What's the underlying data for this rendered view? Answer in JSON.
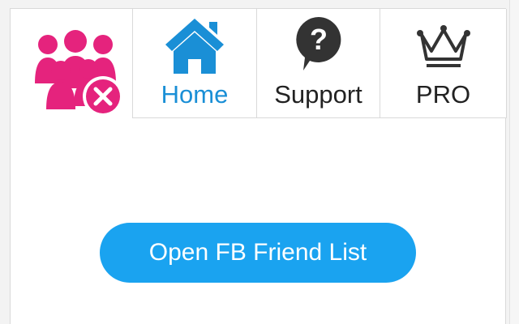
{
  "colors": {
    "logo": "#e5237d",
    "home_accent": "#1a8fd6",
    "button_bg": "#1aa3f0",
    "icon_dark": "#333333"
  },
  "tabs": [
    {
      "label": "Home",
      "icon": "home-icon",
      "active": true
    },
    {
      "label": "Support",
      "icon": "question-bubble-icon",
      "active": false
    },
    {
      "label": "PRO",
      "icon": "crown-icon",
      "active": false
    }
  ],
  "main": {
    "open_button_label": "Open FB Friend List"
  },
  "logo": {
    "icon": "friends-remove-logo"
  }
}
